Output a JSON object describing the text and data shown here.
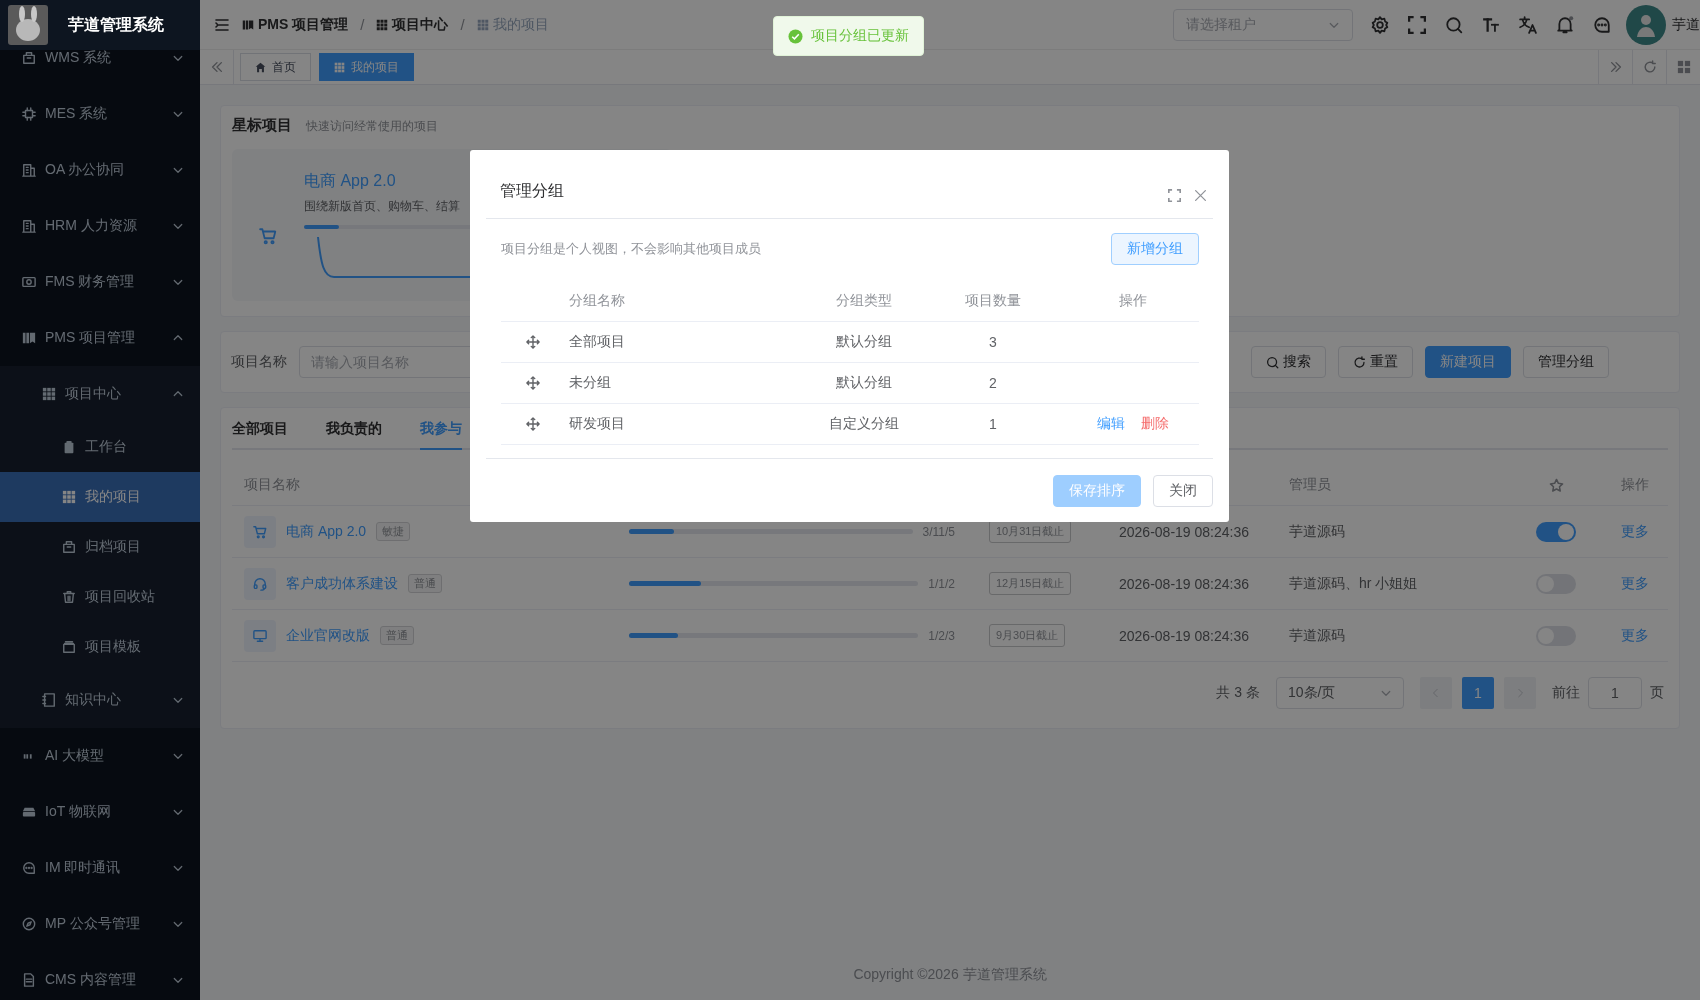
{
  "sidebar": {
    "logo_text": "芋道管理系统",
    "items": [
      {
        "label": "WMS 系统",
        "expanded": false
      },
      {
        "label": "MES 系统",
        "expanded": false
      },
      {
        "label": "OA 办公协同",
        "expanded": false
      },
      {
        "label": "HRM 人力资源",
        "expanded": false
      },
      {
        "label": "FMS 财务管理",
        "expanded": false
      },
      {
        "label": "PMS 项目管理",
        "expanded": true,
        "children": [
          {
            "label": "项目中心",
            "expanded": true,
            "children": [
              {
                "label": "工作台",
                "selected": false
              },
              {
                "label": "我的项目",
                "selected": true
              },
              {
                "label": "归档项目",
                "selected": false
              },
              {
                "label": "项目回收站",
                "selected": false
              },
              {
                "label": "项目模板",
                "selected": false
              }
            ]
          },
          {
            "label": "知识中心",
            "expanded": false
          }
        ]
      },
      {
        "label": "AI 大模型",
        "expanded": false
      },
      {
        "label": "IoT 物联网",
        "expanded": false
      },
      {
        "label": "IM 即时通讯",
        "expanded": false
      },
      {
        "label": "MP 公众号管理",
        "expanded": false
      },
      {
        "label": "CMS 内容管理",
        "expanded": false
      }
    ]
  },
  "header": {
    "breadcrumbs": [
      {
        "label": "PMS 项目管理",
        "current": false
      },
      {
        "separator": "/",
        "label": "项目中心",
        "current": false
      },
      {
        "separator": "/",
        "label": "我的项目",
        "current": true
      }
    ],
    "tenant_select": {
      "placeholder": "请选择租户"
    },
    "user_name": "芋道"
  },
  "tabs_bar": {
    "tabs": [
      {
        "label": "首页",
        "selected": false
      },
      {
        "label": "我的项目",
        "selected": true
      }
    ]
  },
  "starred": {
    "title": "星标项目",
    "subtitle": "快速访问经常使用的项目",
    "projects": [
      {
        "name": "电商 App 2.0",
        "description": "围绕新版首页、购物车、结算",
        "level": 0.11
      }
    ]
  },
  "filter": {
    "label": "项目名称",
    "input": {
      "placeholder": "请输入项目名称"
    },
    "buttons": [
      {
        "label": "搜索",
        "kind": "search"
      },
      {
        "label": "重置",
        "kind": "reset"
      },
      {
        "label": "新建项目",
        "kind": "primary"
      },
      {
        "label": "管理分组",
        "kind": "default"
      }
    ]
  },
  "projects": {
    "tabs": [
      {
        "label": "全部项目",
        "selected": false
      },
      {
        "label": "我负责的",
        "selected": false
      },
      {
        "label": "我参与",
        "selected": true
      }
    ],
    "columns": [
      {
        "label": "项目名称"
      },
      {
        "label": "管理员"
      },
      {
        "kind": "star"
      },
      {
        "label": "操作"
      }
    ],
    "rows": [
      {
        "name": "电商 App 2.0",
        "tag": "敏捷",
        "level": 0.16,
        "reading": "3/11/5",
        "deadline": "10月31日截止",
        "time": "2026-08-19 08:24:36",
        "managers": "芋道源码",
        "on": true,
        "action": "更多"
      },
      {
        "name": "客户成功体系建设",
        "tag": "普通",
        "level": 0.25,
        "reading": "1/1/2",
        "deadline": "12月15日截止",
        "time": "2026-08-19 08:24:36",
        "managers": "芋道源码、hr 小姐姐",
        "on": false,
        "action": "更多"
      },
      {
        "name": "企业官网改版",
        "tag": "普通",
        "level": 0.17,
        "reading": "1/2/3",
        "deadline": "9月30日截止",
        "time": "2026-08-19 08:24:36",
        "managers": "芋道源码",
        "on": false,
        "action": "更多"
      }
    ],
    "pagination": {
      "total": "共 3 条",
      "page_size": "10条/页",
      "pages": [
        {
          "label": "1",
          "selected": true
        }
      ],
      "goto_label": "前往",
      "goto_value": "1",
      "goto_suffix": "页"
    }
  },
  "footer": {
    "copyright": "Copyright ©2026 芋道管理系统"
  },
  "toast": {
    "kind": "success",
    "message": "项目分组已更新"
  },
  "dialog": {
    "title": "管理分组",
    "description": "项目分组是个人视图，不会影响其他项目成员",
    "add_button": "新增分组",
    "columns": [
      "分组名称",
      "分组类型",
      "项目数量",
      "操作"
    ],
    "rows": [
      {
        "name": "全部项目",
        "type": "默认分组",
        "count": "3"
      },
      {
        "name": "未分组",
        "type": "默认分组",
        "count": "2"
      },
      {
        "name": "研发项目",
        "type": "自定义分组",
        "count": "1",
        "actions": [
          {
            "label": "编辑",
            "kind": "edit"
          },
          {
            "label": "删除",
            "kind": "delete"
          }
        ]
      }
    ],
    "buttons": [
      {
        "label": "保存排序",
        "kind": "primary",
        "disabled": true
      },
      {
        "label": "关闭",
        "kind": "default",
        "disabled": false
      }
    ]
  }
}
